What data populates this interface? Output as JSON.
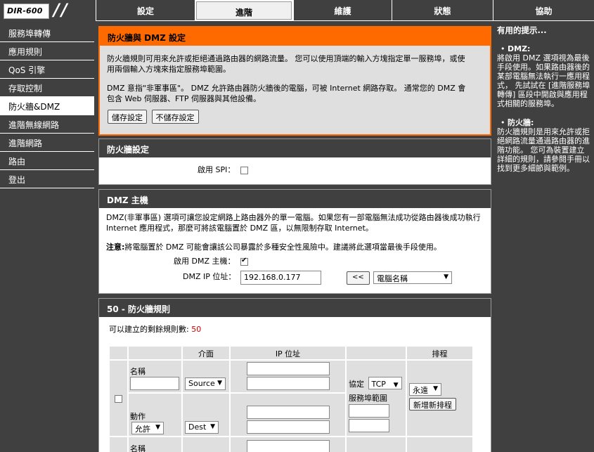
{
  "logo": "DIR-600",
  "tabs": [
    "設定",
    "進階",
    "維護",
    "狀態",
    "協助"
  ],
  "sidebar": [
    "服務埠轉傳",
    "應用規則",
    "QoS 引擎",
    "存取控制",
    "防火牆&DMZ",
    "進階無線網路",
    "進階網路",
    "路由",
    "登出"
  ],
  "intro": {
    "title": "防火牆與 DMZ 設定",
    "p1": "防火牆規則可用來允許或拒絕通過路由器的網路流量。 您可以使用頂端的輸入方塊指定單一服務埠，或使用兩個輸入方塊來指定服務埠範圍。",
    "p2": "DMZ 意指\"非軍事區\"。 DMZ 允許路由器防火牆後的電腦，可被 Internet 網路存取。 通常您的 DMZ 會包含 Web 伺服器、FTP 伺服器與其他設備。",
    "save": "儲存設定",
    "nosave": "不儲存設定"
  },
  "firewall": {
    "title": "防火牆設定",
    "spi_label": "啟用 SPI："
  },
  "dmz": {
    "title": "DMZ 主機",
    "desc": "DMZ(非軍事區) 選項可讓您設定網路上路由器外的單一電腦。如果您有一部電腦無法成功從路由器後成功執行 Internet 應用程式，那麼可將該電腦置於 DMZ 區，以無限制存取 Internet。",
    "note_label": "注意:",
    "note": "將電腦置於 DMZ 可能會讓該公司暴露於多種安全性風險中。建議將此選項當最後手段使用。",
    "enable_label": "啟用 DMZ 主機：",
    "ip_label": "DMZ IP 位址：",
    "ip_value": "192.168.0.177",
    "arrow_btn": "<<",
    "pc_select": "電腦名稱"
  },
  "rules": {
    "count": "50",
    "title_suffix": "- 防火牆規則",
    "remaining_label": "可以建立的剩餘規則數:",
    "remaining": "50",
    "headers": {
      "iface": "介面",
      "ip": "IP 位址",
      "sched": "排程"
    },
    "name_label": "名稱",
    "source": "Source",
    "dest": "Dest",
    "action_label": "動作",
    "action_value": "允許",
    "proto_label": "協定",
    "proto_value": "TCP",
    "port_range_label": "服務埠範圍",
    "sched_value": "永遠",
    "add_sched": "新增新排程"
  },
  "hints": {
    "title": "有用的提示...",
    "dmz_title": "DMZ:",
    "dmz_text": "將啟用 DMZ 選項視為最後手段使用。如果路由器後的某部電腦無法執行一應用程式， 先試試在 [進階服務埠轉傳] 區段中開啟與應用程式相關的服務埠。",
    "fw_title": "防火牆:",
    "fw_text": "防火牆規則是用來允許或拒絕網路流量通過路由器的進階功能。 您可為裝置建立詳細的規則，請參閱手冊以找到更多細節與範例。"
  }
}
